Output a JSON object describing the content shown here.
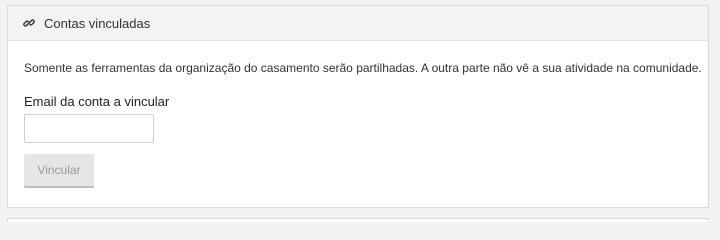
{
  "panel": {
    "title": "Contas vinculadas",
    "icon": "link-icon",
    "description": "Somente as ferramentas da organização do casamento serão partilhadas. A outra parte não vê a sua atividade na comunidade.",
    "email_label": "Email da conta a vincular",
    "email_value": "",
    "email_placeholder": "",
    "submit_label": "Vincular",
    "submit_state": "disabled"
  },
  "colors": {
    "page_background": "#f2f2f2",
    "panel_background": "#ffffff",
    "header_background": "#f3f3f3",
    "button_background": "#e6e6e6",
    "button_text": "#9a9a9a"
  }
}
